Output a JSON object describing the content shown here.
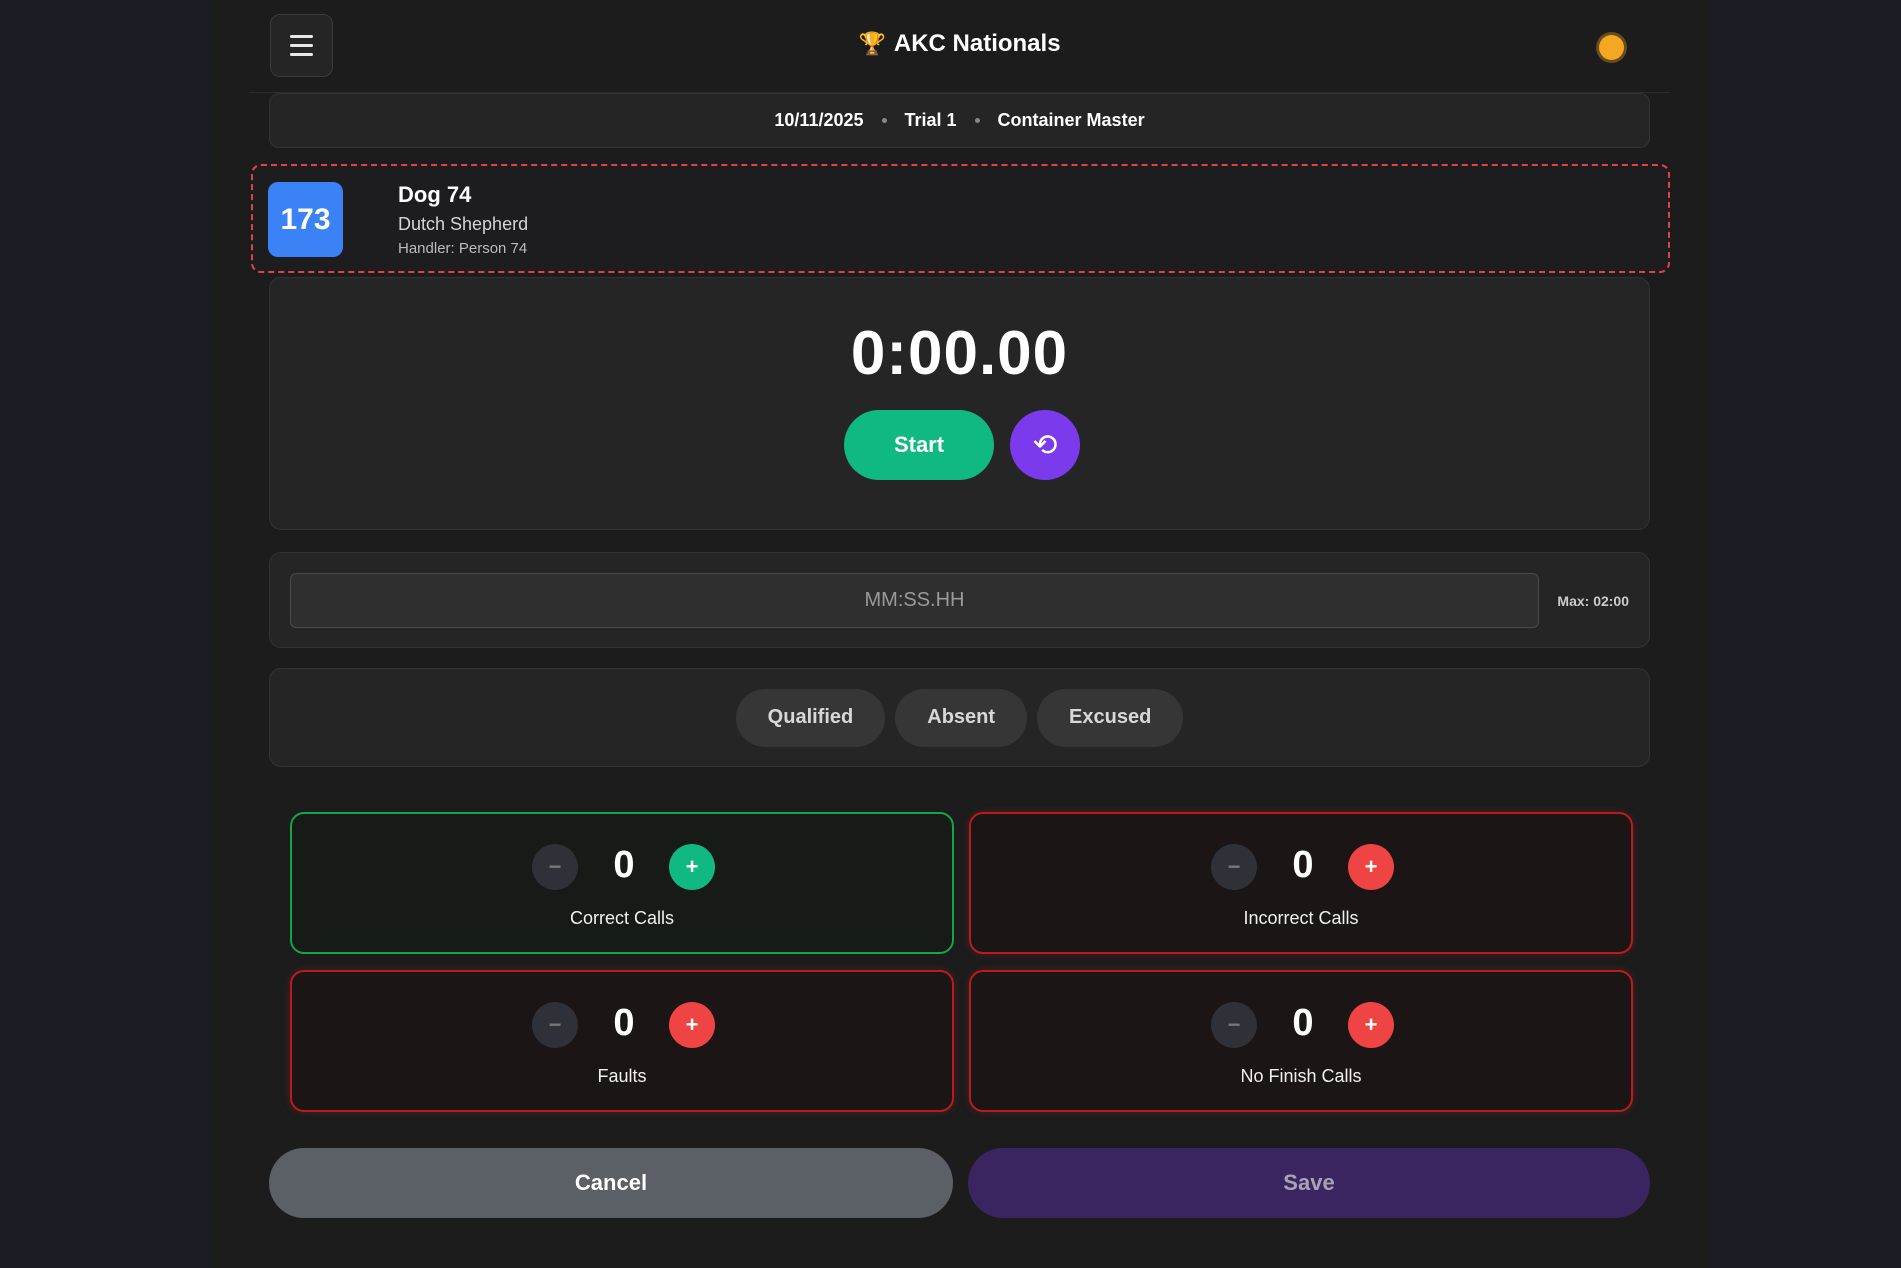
{
  "header": {
    "title": "AKC Nationals",
    "trophy_icon": "🏆",
    "menu_icon": "hamburger-icon",
    "theme_icon": "sun-icon"
  },
  "info": {
    "date": "10/11/2025",
    "trial": "Trial 1",
    "class": "Container Master"
  },
  "dog": {
    "number": "173",
    "name": "Dog 74",
    "breed": "Dutch Shepherd",
    "handler": "Handler: Person 74"
  },
  "timer": {
    "display": "0:00.00",
    "start_label": "Start",
    "reset_icon": "⟲"
  },
  "time_entry": {
    "placeholder": "MM:SS.HH",
    "value": "",
    "max_label": "Max: 02:00"
  },
  "status": {
    "options": [
      "Qualified",
      "Absent",
      "Excused"
    ]
  },
  "counters": [
    {
      "label": "Correct Calls",
      "value": "0",
      "minus": "−",
      "plus": "+",
      "accent": "#10b981"
    },
    {
      "label": "Incorrect Calls",
      "value": "0",
      "minus": "−",
      "plus": "+",
      "accent": "#ef4444"
    },
    {
      "label": "Faults",
      "value": "0",
      "minus": "−",
      "plus": "+",
      "accent": "#ef4444"
    },
    {
      "label": "No Finish Calls",
      "value": "0",
      "minus": "−",
      "plus": "+",
      "accent": "#ef4444"
    }
  ],
  "actions": {
    "cancel_label": "Cancel",
    "save_label": "Save"
  },
  "colors": {
    "accent_blue": "#3b82f6",
    "accent_green": "#10b981",
    "accent_purple": "#7c3aed",
    "alert_red": "#ef4444"
  }
}
